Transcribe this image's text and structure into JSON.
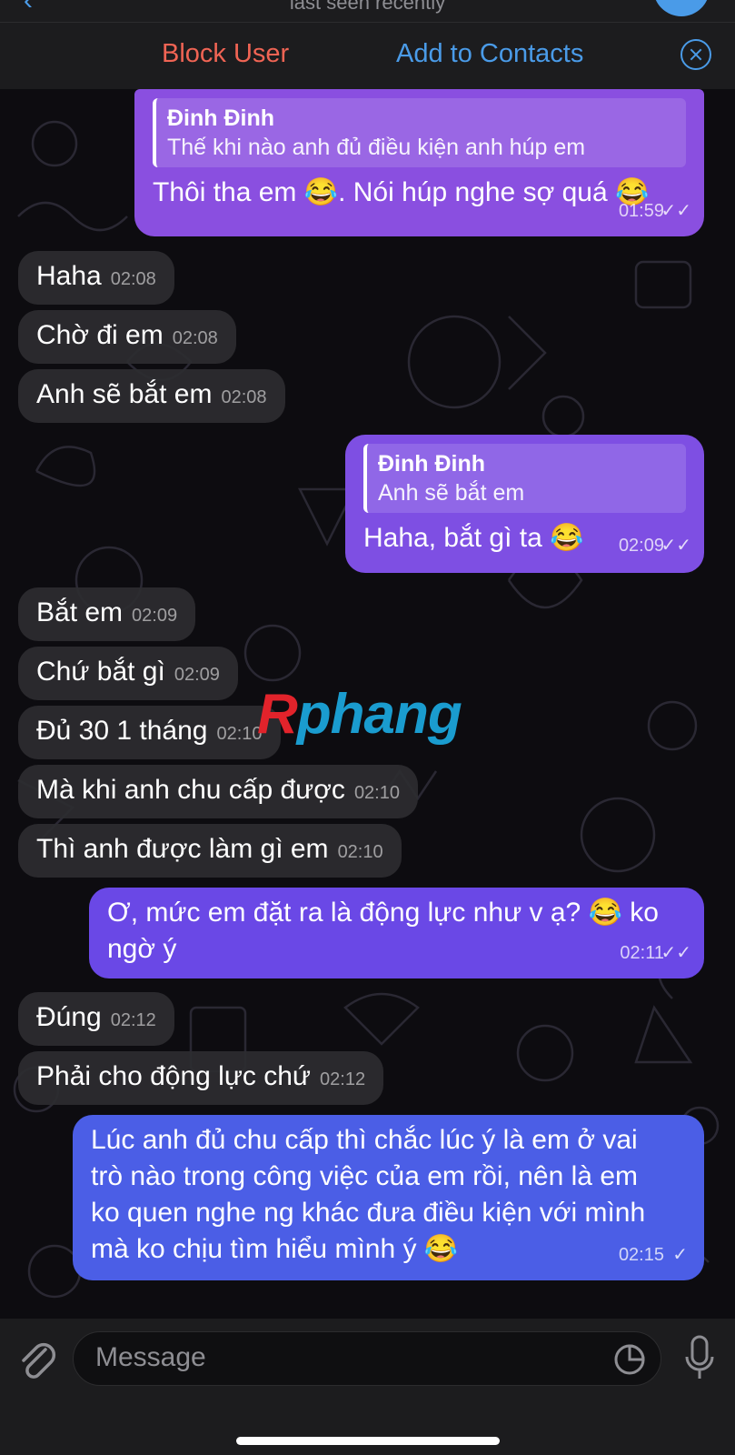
{
  "header": {
    "subtitle": "last seen recently",
    "block_label": "Block User",
    "add_label": "Add to Contacts"
  },
  "messages": [
    {
      "dir": "out",
      "reply_name": "Đinh Đinh",
      "reply_text": "Thế khi nào anh đủ điều kiện anh húp em",
      "text": "Thôi tha em 😂. Nói húp nghe sợ quá 😂",
      "time": "01:59"
    },
    {
      "dir": "in",
      "text": "Haha",
      "time": "02:08"
    },
    {
      "dir": "in",
      "text": "Chờ đi em",
      "time": "02:08"
    },
    {
      "dir": "in",
      "text": "Anh sẽ bắt em",
      "time": "02:08"
    },
    {
      "dir": "out",
      "reply_name": "Đinh Đinh",
      "reply_text": "Anh sẽ bắt em",
      "text": "Haha, bắt gì ta 😂",
      "time": "02:09"
    },
    {
      "dir": "in",
      "text": "Bắt em",
      "time": "02:09"
    },
    {
      "dir": "in",
      "text": "Chứ bắt gì",
      "time": "02:09"
    },
    {
      "dir": "in",
      "text": "Đủ 30 1 tháng",
      "time": "02:10"
    },
    {
      "dir": "in",
      "text": "Mà khi anh chu cấp được",
      "time": "02:10"
    },
    {
      "dir": "in",
      "text": "Thì anh được làm gì em",
      "time": "02:10"
    },
    {
      "dir": "out",
      "text_lines": [
        "Ơ, mức em đặt ra là động lực như v ạ? 😂 ko",
        "ngờ ý"
      ],
      "time": "02:11"
    },
    {
      "dir": "in",
      "text": "Đúng",
      "time": "02:12"
    },
    {
      "dir": "in",
      "text": "Phải cho động lực chứ",
      "time": "02:12"
    },
    {
      "dir": "out",
      "text_lines": [
        "Lúc anh đủ chu cấp thì chắc lúc ý là em ở vai",
        "trò nào trong công việc của em rồi, nên là em",
        "ko quen nghe ng khác đưa điều kiện với mình",
        "mà ko chịu tìm hiểu mình ý 😂"
      ],
      "time": "02:15"
    }
  ],
  "watermark": {
    "r": "R",
    "rest": "phang"
  },
  "input": {
    "placeholder": "Message"
  },
  "colors": {
    "incoming": "#2c2c30",
    "out_purple": "#8a4fe0",
    "out_violet": "#6a48e6",
    "out_blue": "#4b5ee6",
    "block_red": "#f06454",
    "link_blue": "#4a9be8"
  }
}
